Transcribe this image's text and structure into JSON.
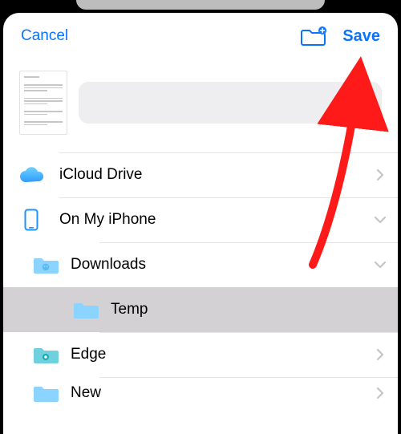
{
  "toolbar": {
    "cancel_label": "Cancel",
    "save_label": "Save"
  },
  "filename_field": {
    "value": "",
    "placeholder": ""
  },
  "locations": {
    "icloud": {
      "label": "iCloud Drive"
    },
    "on_my_iphone": {
      "label": "On My iPhone",
      "children": {
        "downloads": {
          "label": "Downloads",
          "children": {
            "temp": {
              "label": "Temp"
            }
          }
        },
        "edge": {
          "label": "Edge"
        },
        "new": {
          "label": "New"
        }
      }
    }
  },
  "colors": {
    "accent": "#0b74ff",
    "folder_light": "#8ad4ff",
    "folder_edge": "#39c7d6",
    "divider": "#e6e5e7",
    "selected_bg": "#d3d1d4"
  }
}
